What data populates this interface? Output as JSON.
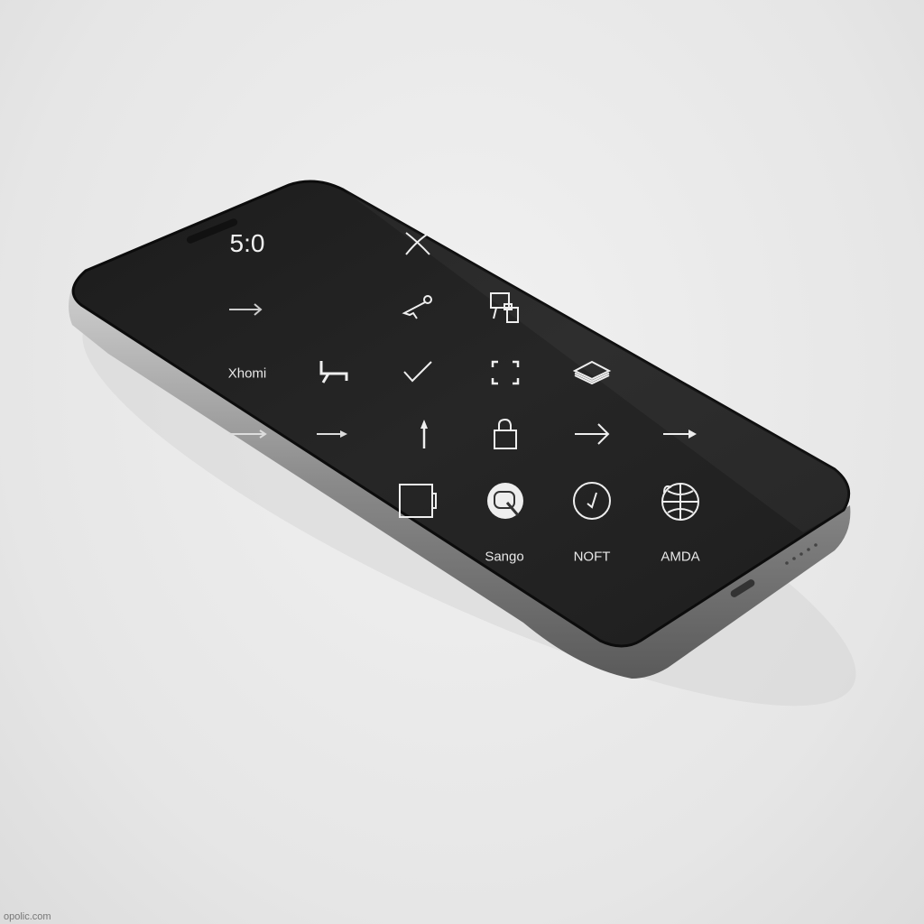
{
  "screen": {
    "time": "5:0",
    "rows": [
      {
        "icons": [
          "close-x-icon"
        ]
      },
      {
        "icons": [
          "arrow-right-icon",
          "key-icon",
          "document-stack-icon"
        ]
      },
      {
        "label": "Xhomi",
        "icons": [
          "bed-icon",
          "checkmark-icon",
          "focus-brackets-icon",
          "layers-icon"
        ]
      },
      {
        "icons": [
          "arrow-right-icon",
          "arrow-right-small-icon",
          "arrow-up-icon",
          "lock-icon",
          "arrow-right-icon",
          "arrow-right-small-icon"
        ]
      },
      {
        "icons": [
          "battery-square-icon",
          "search-app-icon",
          "clock-icon",
          "globe-icon"
        ]
      }
    ],
    "app_labels": [
      "Sango",
      "NOFT",
      "AMDA"
    ]
  },
  "watermark": "opolic.com",
  "colors": {
    "background": "#e9e9e9",
    "screen": "#232323",
    "frame": "#9a9a9a",
    "icon": "#eeeeee"
  }
}
